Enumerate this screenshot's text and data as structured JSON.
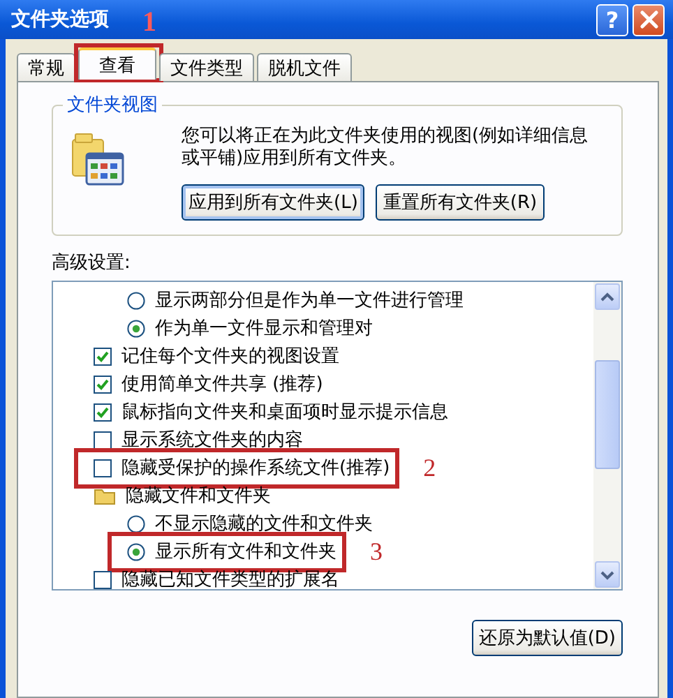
{
  "window": {
    "title": "文件夹选项",
    "help": "?"
  },
  "tabs": [
    {
      "label": "常规",
      "selected": false
    },
    {
      "label": "查看",
      "selected": true,
      "annotation": "1"
    },
    {
      "label": "文件类型",
      "selected": false
    },
    {
      "label": "脱机文件",
      "selected": false
    }
  ],
  "folder_views": {
    "title": "文件夹视图",
    "description": "您可以将正在为此文件夹使用的视图(例如详细信息或平铺)应用到所有文件夹。",
    "buttons": [
      {
        "label": "应用到所有文件夹(L)",
        "focused": true
      },
      {
        "label": "重置所有文件夹(R)",
        "focused": false
      }
    ]
  },
  "advanced": {
    "label": "高级设置:",
    "items": [
      {
        "kind": "radio",
        "label": "显示两部分但是作为单一文件进行管理",
        "selected": false
      },
      {
        "kind": "radio",
        "label": "作为单一文件显示和管理对",
        "selected": true
      },
      {
        "kind": "checkbox",
        "label": "记住每个文件夹的视图设置",
        "checked": true
      },
      {
        "kind": "checkbox",
        "label": "使用简单文件共享 (推荐)",
        "checked": true
      },
      {
        "kind": "checkbox",
        "label": "鼠标指向文件夹和桌面项时显示提示信息",
        "checked": true
      },
      {
        "kind": "checkbox",
        "label": "显示系统文件夹的内容",
        "checked": false
      },
      {
        "kind": "checkbox",
        "label": "隐藏受保护的操作系统文件(推荐)",
        "checked": false,
        "annotation": "2"
      },
      {
        "kind": "folder",
        "label": "隐藏文件和文件夹",
        "children": [
          {
            "kind": "radio",
            "label": "不显示隐藏的文件和文件夹",
            "selected": false
          },
          {
            "kind": "radio",
            "label": "显示所有文件和文件夹",
            "selected": true,
            "annotation": "3"
          }
        ]
      },
      {
        "kind": "checkbox",
        "label": "隐藏已知文件类型的扩展名",
        "checked": false
      }
    ]
  },
  "restore_button": "还原为默认值(D)"
}
